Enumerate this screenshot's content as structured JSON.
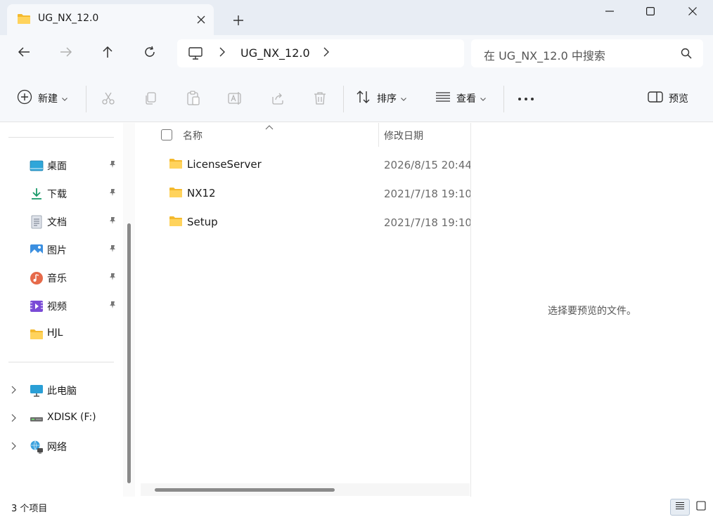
{
  "window": {
    "tab_title": "UG_NX_12.0",
    "tab_icon": "folder-icon",
    "new_tab_icon": "plus-icon",
    "minimize_icon": "minimize-icon",
    "maximize_icon": "maximize-icon",
    "close_icon": "close-icon"
  },
  "nav": {
    "back_icon": "arrow-left-icon",
    "forward_icon": "arrow-right-icon",
    "up_icon": "arrow-up-icon",
    "refresh_icon": "refresh-icon",
    "address": {
      "root_icon": "monitor-icon",
      "crumb": "UG_NX_12.0"
    },
    "search": {
      "placeholder": "在 UG_NX_12.0 中搜索",
      "icon": "search-icon"
    }
  },
  "toolbar": {
    "new_label": "新建",
    "sort_label": "排序",
    "view_label": "查看",
    "preview_label": "预览",
    "icons": [
      "plus-circle-icon",
      "cut-icon",
      "copy-icon",
      "paste-icon",
      "rename-icon",
      "share-icon",
      "delete-icon",
      "sort-icon",
      "view-icon",
      "more-icon",
      "preview-pane-icon"
    ]
  },
  "sidebar": {
    "pinned": [
      {
        "label": "桌面",
        "icon": "desktop-icon",
        "pinned": true
      },
      {
        "label": "下载",
        "icon": "download-icon",
        "pinned": true
      },
      {
        "label": "文档",
        "icon": "document-icon",
        "pinned": true
      },
      {
        "label": "图片",
        "icon": "pictures-icon",
        "pinned": true
      },
      {
        "label": "音乐",
        "icon": "music-icon",
        "pinned": true
      },
      {
        "label": "视频",
        "icon": "video-icon",
        "pinned": true
      },
      {
        "label": "HJL",
        "icon": "folder-icon",
        "pinned": false
      }
    ],
    "locations": [
      {
        "label": "此电脑",
        "icon": "this-pc-icon"
      },
      {
        "label": "XDISK (F:)",
        "icon": "drive-icon"
      },
      {
        "label": "网络",
        "icon": "network-icon"
      }
    ]
  },
  "filelist": {
    "columns": {
      "name": "名称",
      "modified": "修改日期"
    },
    "rows": [
      {
        "name": "LicenseServer",
        "modified": "2026/8/15 20:44"
      },
      {
        "name": "NX12",
        "modified": "2021/7/18 19:10"
      },
      {
        "name": "Setup",
        "modified": "2021/7/18 19:10"
      }
    ]
  },
  "preview": {
    "message": "选择要预览的文件。"
  },
  "status": {
    "item_count": "3 个项目"
  },
  "colors": {
    "chrome": "#f6f8fb",
    "titlebar": "#e8edf4",
    "folder": "#f7c948",
    "accent": "#1f6fd1"
  }
}
